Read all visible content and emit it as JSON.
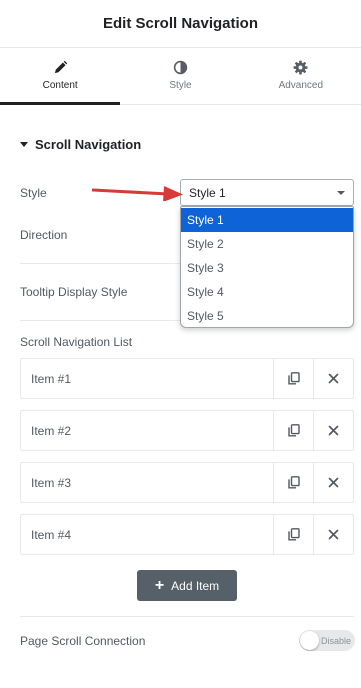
{
  "header": {
    "title": "Edit Scroll Navigation"
  },
  "tabs": [
    {
      "label": "Content",
      "icon": "pencil-icon",
      "active": true
    },
    {
      "label": "Style",
      "icon": "half-circle-icon",
      "active": false
    },
    {
      "label": "Advanced",
      "icon": "gear-icon",
      "active": false
    }
  ],
  "section": {
    "title": "Scroll Navigation"
  },
  "controls": {
    "style_label": "Style",
    "style_value": "Style 1",
    "direction_label": "Direction",
    "tooltip_label": "Tooltip Display Style",
    "list_label": "Scroll Navigation List",
    "page_scroll_label": "Page Scroll Connection",
    "page_scroll_toggle": "Disable"
  },
  "dropdown": {
    "options": [
      "Style 1",
      "Style 2",
      "Style 3",
      "Style 4",
      "Style 5"
    ],
    "selected": "Style 1"
  },
  "repeater": {
    "items": [
      {
        "title": "Item #1"
      },
      {
        "title": "Item #2"
      },
      {
        "title": "Item #3"
      },
      {
        "title": "Item #4"
      }
    ],
    "add_label": "Add Item"
  },
  "colors": {
    "arrow": "#d63a3a",
    "selected_option": "#0e63d6",
    "add_button": "#556068"
  }
}
